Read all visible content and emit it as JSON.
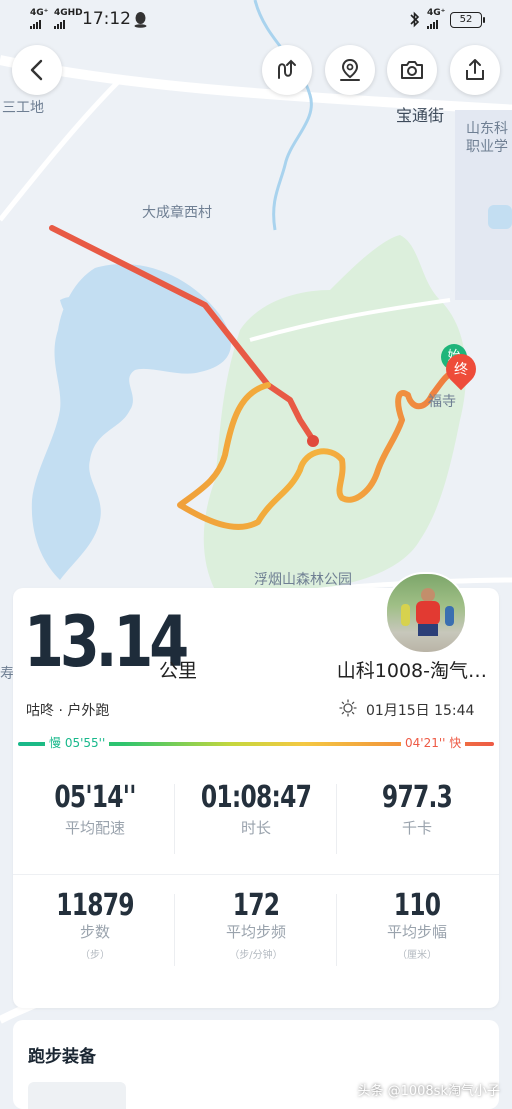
{
  "status": {
    "sim1": "4G⁺",
    "sim2": "4GHD",
    "time": "17:12",
    "net": "4G⁺",
    "battery": "52"
  },
  "map": {
    "labels": [
      "三工地",
      "宝通街",
      "山东科",
      "职业学",
      "大成章西村",
      "福寺",
      "浮烟山森林公园",
      "寿"
    ],
    "start_marker": "始",
    "end_marker": "终",
    "route_colors": {
      "slow": "#2ec46e",
      "mid": "#f4a53c",
      "fast": "#ee5a45"
    }
  },
  "toolbar": {
    "icons": [
      "back-icon",
      "route-toggle-icon",
      "location-icon",
      "camera-icon",
      "share-icon"
    ]
  },
  "summary": {
    "distance": "13.14",
    "unit": "公里",
    "user_name": "山科1008-淘气…",
    "activity": "咕咚 · 户外跑",
    "datetime": "01月15日 15:44",
    "pace_slow_label": "慢 05'55''",
    "pace_fast_label": "04'21'' 快"
  },
  "stats_row1": [
    {
      "value": "05'14''",
      "label": "平均配速"
    },
    {
      "value": "01:08:47",
      "label": "时长"
    },
    {
      "value": "977.3",
      "label": "千卡"
    }
  ],
  "stats_row2": [
    {
      "value": "11879",
      "label": "步数",
      "unit": "（步）"
    },
    {
      "value": "172",
      "label": "平均步频",
      "unit": "（步/分钟）"
    },
    {
      "value": "110",
      "label": "平均步幅",
      "unit": "（厘米）"
    }
  ],
  "gear": {
    "title": "跑步装备"
  },
  "watermark": "头条 @1008sk淘气小子"
}
